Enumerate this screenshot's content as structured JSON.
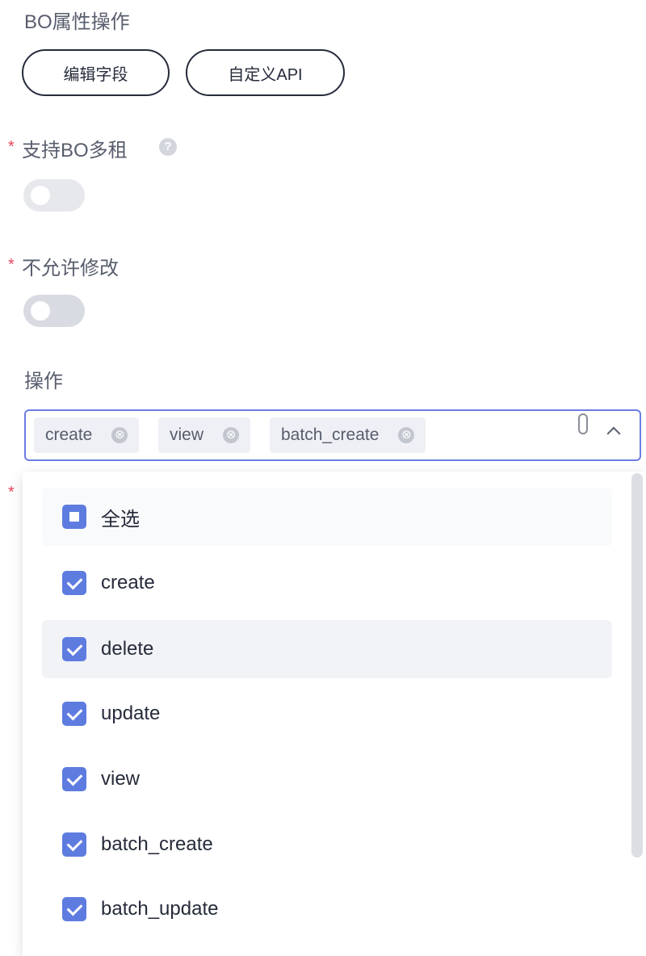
{
  "bo_ops": {
    "label": "BO属性操作",
    "edit_fields_button": "编辑字段",
    "custom_api_button": "自定义API"
  },
  "multi_tenant": {
    "label": "支持BO多租",
    "help_icon": "?",
    "toggle_on": false,
    "toggle_disabled": true
  },
  "not_modifiable": {
    "label": "不允许修改",
    "toggle_on": false
  },
  "operations": {
    "label": "操作",
    "tags": [
      "create",
      "view",
      "batch_create"
    ],
    "tag_close_icon": "⊗",
    "options": [
      {
        "label": "全选",
        "state": "partial"
      },
      {
        "label": "create",
        "state": "checked"
      },
      {
        "label": "delete",
        "state": "checked"
      },
      {
        "label": "update",
        "state": "checked"
      },
      {
        "label": "view",
        "state": "checked"
      },
      {
        "label": "batch_create",
        "state": "checked"
      },
      {
        "label": "batch_update",
        "state": "checked"
      }
    ]
  },
  "required_marker": "*",
  "colors": {
    "primary": "#5e7ce0",
    "required": "#e7455e",
    "border_active": "#6b7de3",
    "text": "#252b3a"
  }
}
